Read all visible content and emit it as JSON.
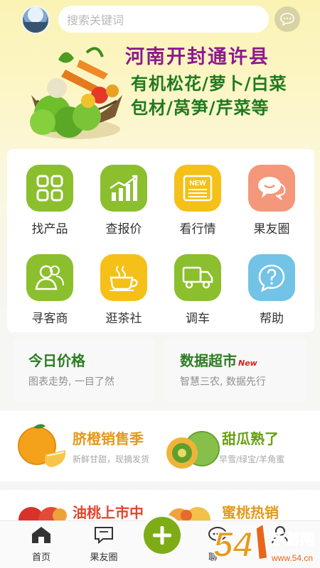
{
  "search": {
    "placeholder": "搜索关键词"
  },
  "banner": {
    "title": "河南开封通许县",
    "line1": "有机松花/萝卜/白菜",
    "line2": "包材/莴笋/芹菜等"
  },
  "categories": [
    {
      "label": "找产品",
      "icon": "grid-icon",
      "color": "#8bbf2d"
    },
    {
      "label": "查报价",
      "icon": "chart-icon",
      "color": "#8bbf2d"
    },
    {
      "label": "看行情",
      "icon": "news-icon",
      "color": "#f5c018"
    },
    {
      "label": "果友圈",
      "icon": "chat-bubbles-icon",
      "color": "#f4977a"
    },
    {
      "label": "寻客商",
      "icon": "people-icon",
      "color": "#8bbf2d"
    },
    {
      "label": "逛茶社",
      "icon": "tea-cup-icon",
      "color": "#f5c018"
    },
    {
      "label": "调车",
      "icon": "truck-icon",
      "color": "#8bbf2d"
    },
    {
      "label": "帮助",
      "icon": "help-icon",
      "color": "#72c3e5"
    }
  ],
  "cards": {
    "price": {
      "title": "今日价格",
      "sub": "图表走势, 一目了然"
    },
    "data": {
      "title": "数据超市",
      "badge": "New",
      "sub": "智慧三农, 数据先行"
    }
  },
  "promos": {
    "orange": {
      "title": "脐橙销售季",
      "sub": "新鲜甘甜，现摘发货"
    },
    "melon": {
      "title": "甜瓜熟了",
      "sub": "早雪/绿宝/羊角蜜"
    },
    "peach": {
      "title": "油桃上市中"
    },
    "honeypeach": {
      "title": "蜜桃热销"
    }
  },
  "nav": {
    "home": "首页",
    "moments": "果友圈",
    "chat": "聊一"
  },
  "watermark": {
    "brand": "手游网",
    "domain": "www.54.cn",
    "num": "54"
  },
  "colors": {
    "accent": "#7dac17",
    "title_green": "#2d7d23",
    "promo_orange": "#e39a18",
    "banner_purple": "#8d1a8d"
  }
}
